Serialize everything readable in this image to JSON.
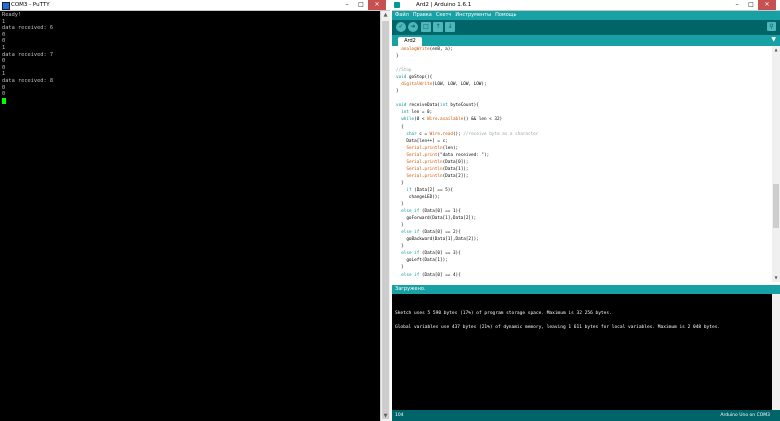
{
  "putty": {
    "title": "COM3 - PuTTY",
    "terminal_lines": [
      "Ready!",
      "1",
      "data received: 6",
      "0",
      "0",
      "1",
      "data received: 7",
      "0",
      "0",
      "1",
      "data received: 8",
      "0",
      "0"
    ]
  },
  "ide": {
    "title": "Ard2 | Arduino 1.6.1",
    "menu": [
      "Файл",
      "Правка",
      "Скетч",
      "Инструменты",
      "Помощь"
    ],
    "toolbar": {
      "verify_icon": "checkmark-icon",
      "upload_icon": "arrow-right-icon",
      "new_icon": "new-file-icon",
      "open_icon": "arrow-up-icon",
      "save_icon": "arrow-down-icon",
      "serial_icon": "magnifier-icon"
    },
    "tab": "Ard2",
    "code_lines": [
      "  analogWrite(enB, a);",
      "}",
      "",
      "//Stop",
      "void goStop(){",
      "  digitalWrite(LOW, LOW, LOW, LOW);",
      "}",
      "",
      "void receiveData(int byteCount){",
      "  int len = 0;",
      "  while(0 < Wire.available() && len < 32)",
      "  {",
      "    char c = Wire.read(); //receive byte as a character",
      "    Data[len++] = c;",
      "    Serial.println(len);",
      "    Serial.print(\"data received: \");",
      "    Serial.println(Data[0]);",
      "    Serial.println(Data[1]);",
      "    Serial.println(Data[2]);",
      "  }",
      "    if (Data[2] == 5){",
      "     changeLED();",
      "  }",
      "  else if (Data[0] == 1){",
      "    goForward(Data[1],Data[2]);",
      "  }",
      "  else if (Data[0] == 2){",
      "    goBackward(Data[1],Data[2]);",
      "  }",
      "  else if (Data[0] == 3){",
      "    goLeft(Data[1]);",
      "  }",
      "  else if (Data[0] == 4){"
    ],
    "status": "Загружено.",
    "console_lines": [
      "Sketch uses 5 590 bytes (17%) of program storage space. Maximum is 32 256 bytes.",
      "Global variables use 437 bytes (21%) of dynamic memory, leaving 1 611 bytes for local variables. Maximum is 2 048 bytes."
    ],
    "line_number": "104",
    "board": "Arduino Uno on COM3"
  }
}
